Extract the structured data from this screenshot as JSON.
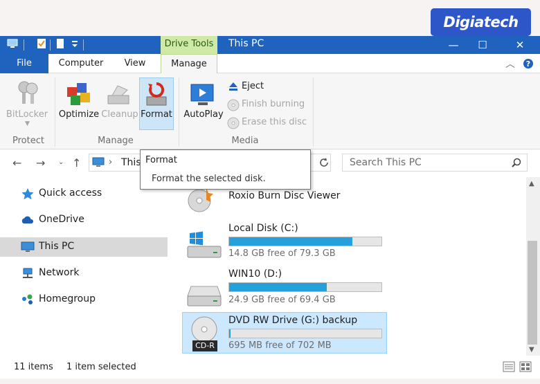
{
  "watermark": {
    "logo_text": "Digiatech"
  },
  "titlebar": {
    "title": "This PC",
    "context_tab": "Drive Tools",
    "minimize": "—",
    "maximize": "☐",
    "close": "✕"
  },
  "tabs": {
    "file": "File",
    "computer": "Computer",
    "view": "View",
    "manage": "Manage"
  },
  "ribbon": {
    "protect": {
      "bitlocker": "BitLocker",
      "group": "Protect"
    },
    "manage": {
      "optimize": "Optimize",
      "cleanup": "Cleanup",
      "format": "Format",
      "group": "Manage"
    },
    "media": {
      "autoplay": "AutoPlay",
      "eject": "Eject",
      "finish_burning": "Finish burning",
      "erase_disc": "Erase this disc",
      "group": "Media"
    }
  },
  "address": {
    "path_visible": "This",
    "search_placeholder": "Search This PC"
  },
  "tooltip": {
    "title": "Format",
    "body": "Format the selected disk."
  },
  "nav": {
    "items": [
      {
        "label": "Quick access",
        "icon": "star-icon"
      },
      {
        "label": "OneDrive",
        "icon": "cloud-icon"
      },
      {
        "label": "This PC",
        "icon": "computer-icon",
        "selected": true
      },
      {
        "label": "Network",
        "icon": "network-icon"
      },
      {
        "label": "Homegroup",
        "icon": "homegroup-icon"
      }
    ]
  },
  "drives": {
    "roxio": {
      "name": "Roxio Burn Disc Viewer"
    },
    "c": {
      "name": "Local Disk (C:)",
      "free": "14.8 GB free of 79.3 GB",
      "used_fraction": 0.81
    },
    "d": {
      "name": "WIN10 (D:)",
      "free": "24.9 GB free of 69.4 GB",
      "used_fraction": 0.64
    },
    "g": {
      "name": "DVD RW Drive (G:) backup",
      "free": "695 MB free of 702 MB",
      "used_fraction": 0.01,
      "badge": "CD-R"
    }
  },
  "status": {
    "items": "11 items",
    "selected": "1 item selected"
  },
  "colors": {
    "accent": "#1f63bf",
    "selection": "#cce8ff",
    "bar": "#26a0da",
    "context_tab": "#cfeaa6"
  }
}
